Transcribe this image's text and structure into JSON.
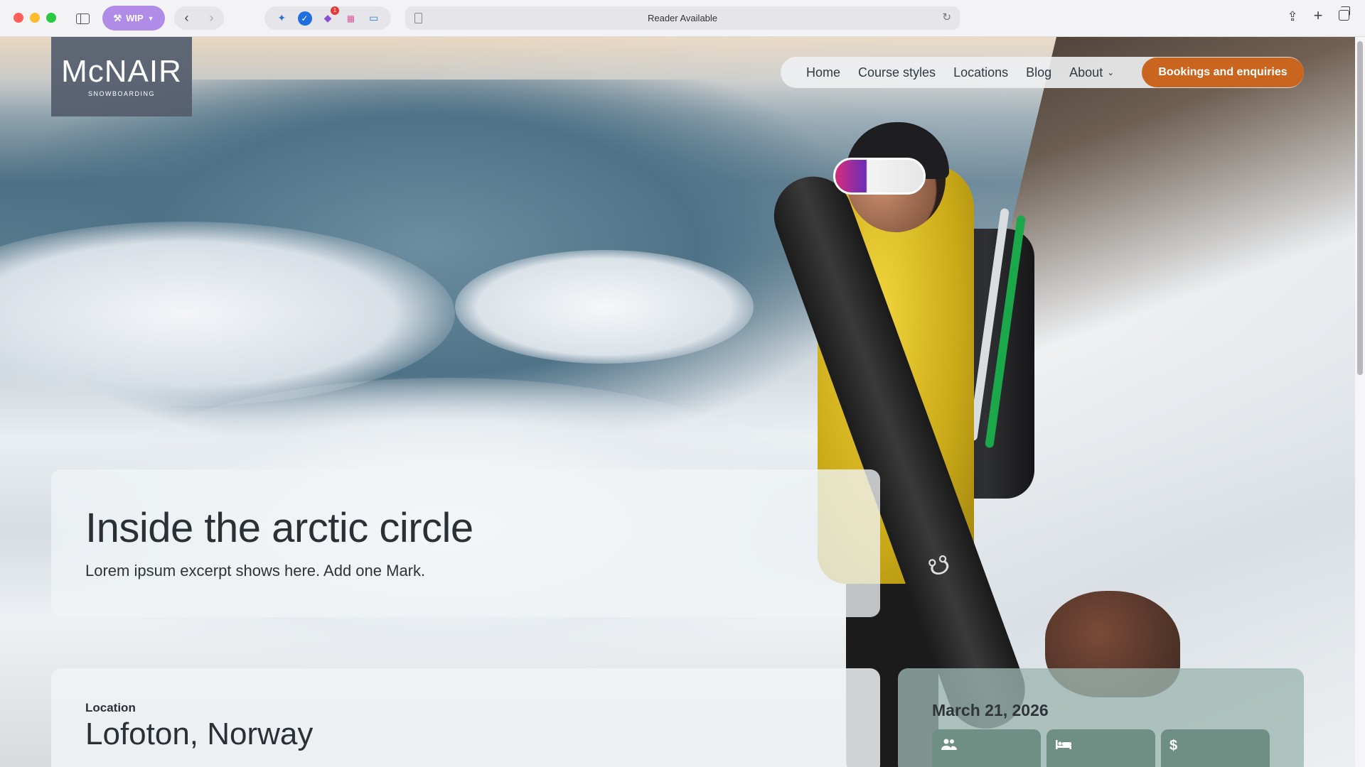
{
  "browser": {
    "wip_label": "WIP",
    "url_text": "Reader Available",
    "extension_badge": "1"
  },
  "site": {
    "logo_main": "McNAIR",
    "logo_sub": "SNOWBOARDING",
    "nav": {
      "home": "Home",
      "course_styles": "Course styles",
      "locations": "Locations",
      "blog": "Blog",
      "about": "About"
    },
    "cta_label": "Bookings and enquiries"
  },
  "hero": {
    "title": "Inside the arctic circle",
    "excerpt": "Lorem ipsum excerpt shows here. Add one Mark."
  },
  "location": {
    "label": "Location",
    "value": "Lofoton, Norway"
  },
  "trip": {
    "date": "March 21, 2026",
    "stats": [
      {
        "icon": "group-icon"
      },
      {
        "icon": "bed-icon"
      },
      {
        "icon": "dollar-icon",
        "symbol": "$"
      }
    ]
  },
  "colors": {
    "cta": "#c9651f",
    "wip_pill": "#b08be8",
    "stat_tile": "#6f8f84"
  }
}
